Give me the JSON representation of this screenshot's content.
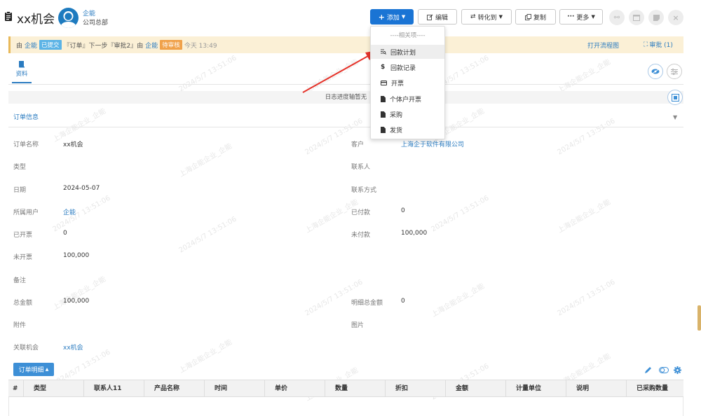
{
  "header": {
    "title": "xx机会",
    "user_name": "企能",
    "user_dept": "公司总部",
    "buttons": {
      "add": "添加",
      "edit": "编辑",
      "convert": "转化到",
      "copy": "复制",
      "more": "更多"
    }
  },
  "banner": {
    "by1": "由",
    "user1": "企能",
    "status1": "已提交",
    "text1": "『订单』下一步『审批2』由",
    "user2": "企能",
    "status2": "待审核",
    "time": "今天 13:49",
    "open_flow": "打开流程图",
    "approve": "审批 (1)"
  },
  "tabs": {
    "data": "资料"
  },
  "log_text": "日志进度轴暂无",
  "section_title": "订单信息",
  "fields": {
    "order_name_label": "订单名称",
    "order_name": "xx机会",
    "customer_label": "客户",
    "customer": "上海企于软件有限公司",
    "type_label": "类型",
    "contact_label": "联系人",
    "date_label": "日期",
    "date": "2024-05-07",
    "contact_method_label": "联系方式",
    "owner_label": "所属用户",
    "owner": "企能",
    "paid_label": "已付款",
    "paid": "0",
    "invoiced_label": "已开票",
    "invoiced": "0",
    "unpaid_label": "未付款",
    "unpaid": "100,000",
    "uninvoiced_label": "未开票",
    "uninvoiced": "100,000",
    "remark_label": "备注",
    "total_label": "总金额",
    "total": "100,000",
    "detail_total_label": "明细总金额",
    "detail_total": "0",
    "attachment_label": "附件",
    "image_label": "图片",
    "related_label": "关联机会",
    "related": "xx机会"
  },
  "detail_tab": "订单明细",
  "table_headers": [
    "#",
    "类型",
    "联系人11",
    "产品名称",
    "时间",
    "单价",
    "数量",
    "折扣",
    "金额",
    "计量单位",
    "说明",
    "已采购数量"
  ],
  "dropdown": {
    "header": "----相关项----",
    "items": [
      "回款计划",
      "回款记录",
      "开票",
      "个体户开票",
      "采购",
      "发货"
    ]
  },
  "watermark": "上海企能企业_企能",
  "watermark_time": "2024/5/7 13:51:06",
  "colors": {
    "primary": "#1a74d4",
    "link": "#2a7bc0",
    "submitted": "#5bb3e6",
    "pending": "#f0a14a",
    "banner_bg": "#fbf0d6"
  }
}
